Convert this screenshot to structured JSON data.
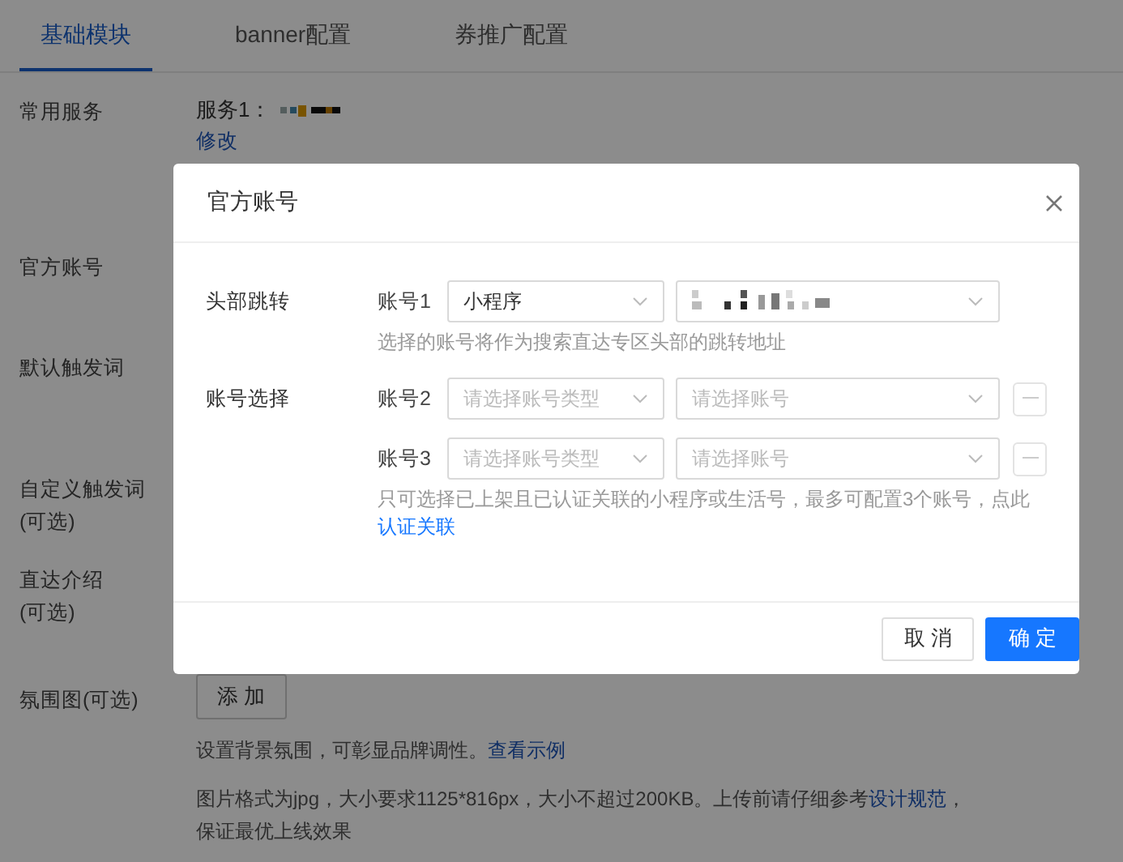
{
  "tabs": [
    {
      "label": "基础模块",
      "selected": true
    },
    {
      "label": "banner配置",
      "selected": false
    },
    {
      "label": "券推广配置",
      "selected": false
    }
  ],
  "form": [
    {
      "label_lines": [
        "常用服务"
      ],
      "kind": "service",
      "service_label": "服务1：",
      "value_redacted": true,
      "link": "修改"
    },
    {
      "label_lines": [
        "官方账号"
      ],
      "kind": "empty"
    },
    {
      "label_lines": [
        "默认触发词"
      ],
      "kind": "empty"
    },
    {
      "label_lines": [
        "自定义触发词",
        "(可选)"
      ],
      "kind": "empty"
    },
    {
      "label_lines": [
        "直达介绍",
        "(可选)"
      ],
      "kind": "empty"
    },
    {
      "label_lines": [
        "氛围图(可选)"
      ],
      "kind": "upload",
      "button": "添 加",
      "hint": "设置背景氛围，可彰显品牌调性。",
      "hint_link": "查看示例",
      "spec_before": "图片格式为jpg，大小要求1125*816px，大小不超过200KB。上传前请仔细参考",
      "spec_link": "设计规范",
      "spec_after": "，保证最优上线效果"
    }
  ],
  "modal": {
    "title": "官方账号",
    "sections": [
      {
        "label": "头部跳转",
        "accounts": [
          {
            "label": "账号1",
            "type": {
              "value": "小程序"
            },
            "account": {
              "redacted": true
            },
            "removable": false
          }
        ],
        "hint": "选择的账号将作为搜索直达专区头部的跳转地址"
      },
      {
        "label": "账号选择",
        "accounts": [
          {
            "label": "账号2",
            "type": {
              "placeholder": "请选择账号类型"
            },
            "account": {
              "placeholder": "请选择账号"
            },
            "removable": true
          },
          {
            "label": "账号3",
            "type": {
              "placeholder": "请选择账号类型"
            },
            "account": {
              "placeholder": "请选择账号"
            },
            "removable": true
          }
        ],
        "hint": "只可选择已上架且已认证关联的小程序或生活号，最多可配置3个账号，点此",
        "hint_link": "认证关联"
      }
    ],
    "buttons": [
      {
        "label": "取 消",
        "primary": false
      },
      {
        "label": "确 定",
        "primary": true
      }
    ]
  }
}
